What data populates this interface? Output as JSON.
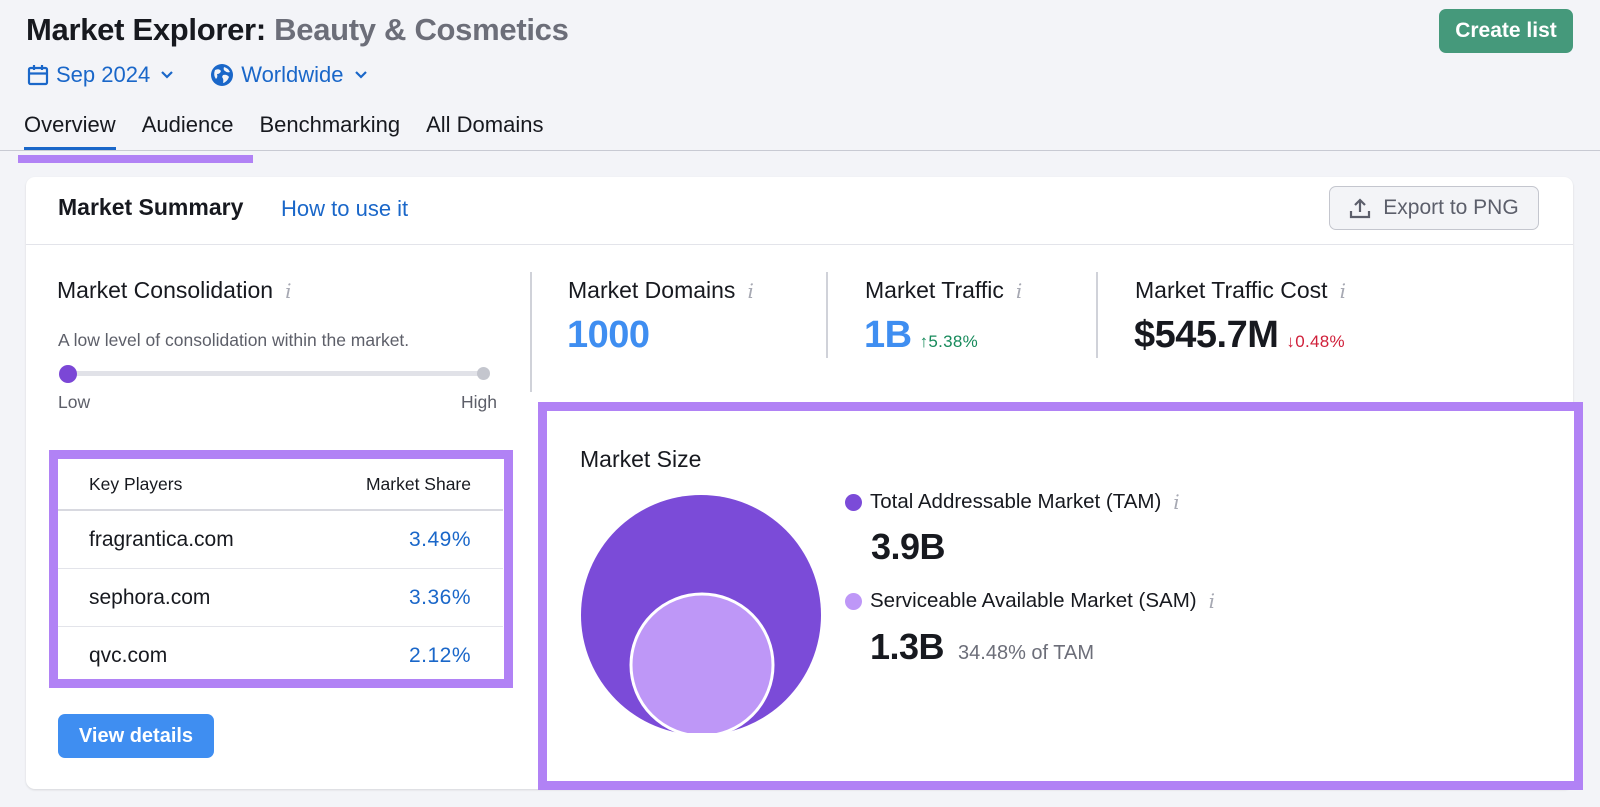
{
  "header": {
    "title": "Market Explorer:",
    "subtitle": "Beauty & Cosmetics",
    "create_list_label": "Create list",
    "filters": {
      "date": {
        "label": "Sep 2024",
        "icon": "calendar-icon"
      },
      "region": {
        "label": "Worldwide",
        "icon": "globe-icon"
      }
    }
  },
  "tabs": [
    {
      "label": "Overview",
      "active": true
    },
    {
      "label": "Audience",
      "active": false
    },
    {
      "label": "Benchmarking",
      "active": false
    },
    {
      "label": "All Domains",
      "active": false
    }
  ],
  "summary": {
    "title": "Market Summary",
    "how_to_label": "How to use it",
    "export_label": "Export to PNG",
    "consolidation": {
      "label": "Market Consolidation",
      "description": "A low level of consolidation within the market.",
      "level": 0,
      "low_label": "Low",
      "high_label": "High"
    },
    "key_players": {
      "col_player": "Key Players",
      "col_share": "Market Share",
      "rows": [
        {
          "domain": "fragrantica.com",
          "share": "3.49%"
        },
        {
          "domain": "sephora.com",
          "share": "3.36%"
        },
        {
          "domain": "qvc.com",
          "share": "2.12%"
        }
      ]
    },
    "view_details_label": "View details",
    "metrics": {
      "domains": {
        "label": "Market Domains",
        "value": "1000"
      },
      "traffic": {
        "label": "Market Traffic",
        "value": "1B",
        "delta": "5.38%",
        "delta_dir": "up"
      },
      "cost": {
        "label": "Market Traffic Cost",
        "value": "$545.7M",
        "delta": "0.48%",
        "delta_dir": "down"
      }
    },
    "market_size": {
      "title": "Market Size",
      "tam": {
        "label": "Total Addressable Market (TAM)",
        "value": "3.9B",
        "color": "#7b4bd8"
      },
      "sam": {
        "label": "Serviceable Available Market (SAM)",
        "value": "1.3B",
        "pct_of_tam": "34.48% of TAM",
        "color": "#be97f7"
      }
    }
  },
  "colors": {
    "accent_blue": "#1a67c9",
    "primary_button": "#3f8ef1",
    "create_button": "#45997b",
    "highlight": "#b182f5",
    "up": "#178a5b",
    "down": "#d0203a"
  }
}
